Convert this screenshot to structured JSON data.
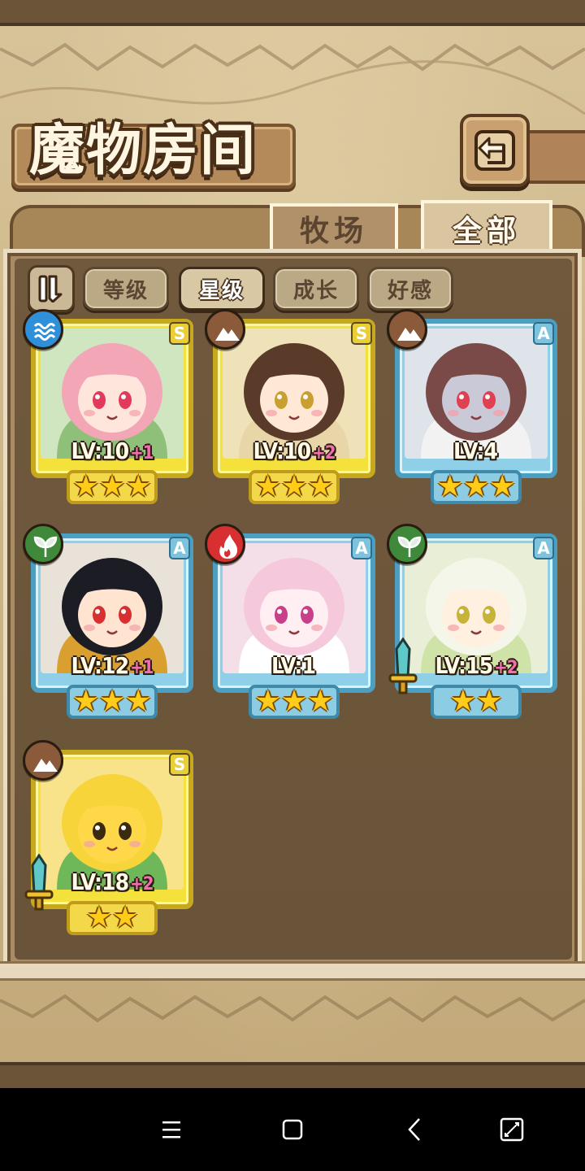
{
  "header": {
    "title": "魔物房间",
    "back_icon": "back-arrow-icon"
  },
  "tabs": [
    {
      "label": "牧场",
      "selected": false
    },
    {
      "label": "全部",
      "selected": true
    }
  ],
  "filters": {
    "sort_icon": "sort-order-icon",
    "items": [
      {
        "label": "等级",
        "selected": false
      },
      {
        "label": "星级",
        "selected": true
      },
      {
        "label": "成长",
        "selected": false
      },
      {
        "label": "好感",
        "selected": false
      }
    ]
  },
  "monsters": [
    {
      "rank": "S",
      "element": "water",
      "element_color": "#2f8fd8",
      "level": "LV:10",
      "plus": "+1",
      "stars": 3,
      "weapon": false
    },
    {
      "rank": "S",
      "element": "earth",
      "element_color": "#8a5a3a",
      "level": "LV:10",
      "plus": "+2",
      "stars": 3,
      "weapon": false
    },
    {
      "rank": "A",
      "element": "earth",
      "element_color": "#8a5a3a",
      "level": "LV:4",
      "plus": "",
      "stars": 3,
      "weapon": false
    },
    {
      "rank": "A",
      "element": "wood",
      "element_color": "#3f8a3a",
      "level": "LV:12",
      "plus": "+1",
      "stars": 3,
      "weapon": false
    },
    {
      "rank": "A",
      "element": "fire",
      "element_color": "#d83030",
      "level": "LV:1",
      "plus": "",
      "stars": 3,
      "weapon": false
    },
    {
      "rank": "A",
      "element": "wood",
      "element_color": "#3f8a3a",
      "level": "LV:15",
      "plus": "+2",
      "stars": 2,
      "weapon": true
    },
    {
      "rank": "S",
      "element": "earth",
      "element_color": "#8a5a3a",
      "level": "LV:18",
      "plus": "+2",
      "stars": 2,
      "weapon": true
    }
  ],
  "navbar": {
    "menu_icon": "menu-icon",
    "home_icon": "home-square-icon",
    "back_icon": "back-chevron-icon",
    "rotate_icon": "screen-rotate-icon"
  }
}
